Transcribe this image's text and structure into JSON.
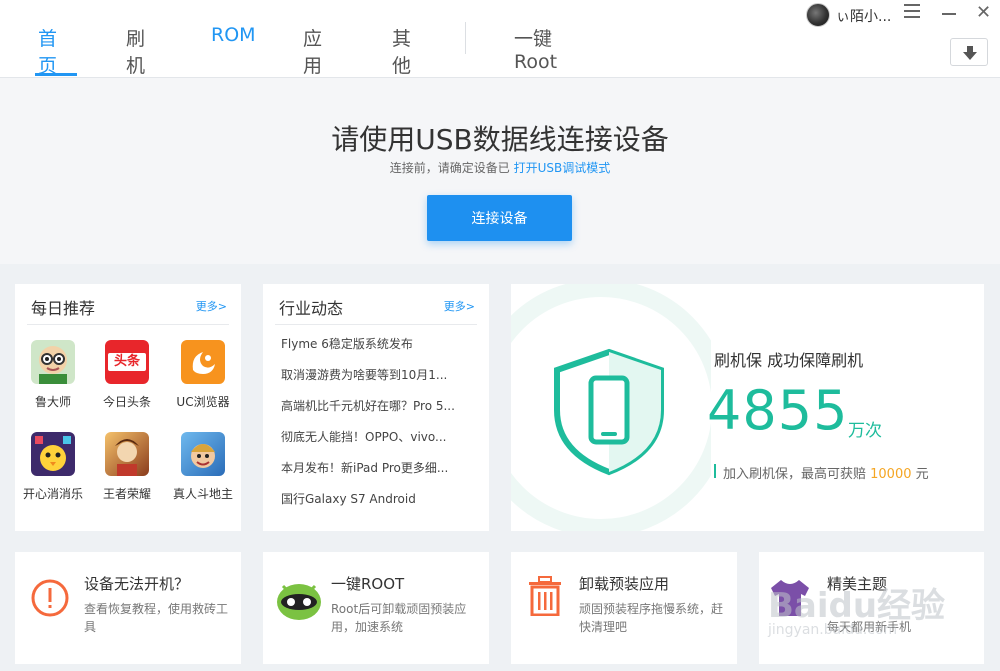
{
  "nav": {
    "items": [
      "首页",
      "刷机",
      "ROM",
      "应用",
      "其他",
      "一键Root"
    ],
    "active": "首页"
  },
  "titlebar": {
    "username": "ぃ陌小..."
  },
  "hero": {
    "title": "请使用USB数据线连接设备",
    "subtitle_prefix": "连接前，请确定设备已",
    "subtitle_link": "打开USB调试模式",
    "button": "连接设备"
  },
  "daily": {
    "title": "每日推荐",
    "more": "更多>",
    "apps": [
      {
        "name": "鲁大师",
        "icon": "ludashi-icon"
      },
      {
        "name": "今日头条",
        "icon": "toutiao-icon"
      },
      {
        "name": "UC浏览器",
        "icon": "uc-browser-icon"
      },
      {
        "name": "开心消消乐",
        "icon": "xiaoxiaole-icon"
      },
      {
        "name": "王者荣耀",
        "icon": "wangzhe-icon"
      },
      {
        "name": "真人斗地主",
        "icon": "doudizhu-icon"
      }
    ],
    "toutiao_logo": "头条"
  },
  "news": {
    "title": "行业动态",
    "more": "更多>",
    "items": [
      "Flyme 6稳定版系统发布",
      "取消漫游费为啥要等到10月1...",
      "高端机比千元机好在哪？Pro 5...",
      "彻底无人能挡！OPPO、vivo...",
      "本月发布！新iPad Pro更多细...",
      "国行Galaxy S7 Android"
    ]
  },
  "promo": {
    "title": "刷机保  成功保障刷机",
    "count": "4855",
    "unit": "万次",
    "text_prefix": "加入刷机保，最高可获赔 ",
    "amount": "10000",
    "text_suffix": " 元",
    "accent": "#1ebc9c"
  },
  "bottom": [
    {
      "title": "设备无法开机？",
      "desc": "查看恢复教程，使用救砖工具",
      "icon": "warning-icon"
    },
    {
      "title": "一键ROOT",
      "desc": "Root后可卸载顽固预装应用，加速系统",
      "icon": "root-robot-icon"
    },
    {
      "title": "卸载预装应用",
      "desc": "顽固预装程序拖慢系统，赶快清理吧",
      "icon": "trash-icon"
    },
    {
      "title": "精美主题",
      "desc": "每天都用新手机",
      "icon": "theme-shirt-icon"
    }
  ],
  "watermark": {
    "brand": "Baidu经验",
    "url": "jingyan.baidu.com"
  },
  "colors": {
    "primary": "#2196f3",
    "teal": "#1ebc9c",
    "orange": "#f5a623"
  }
}
